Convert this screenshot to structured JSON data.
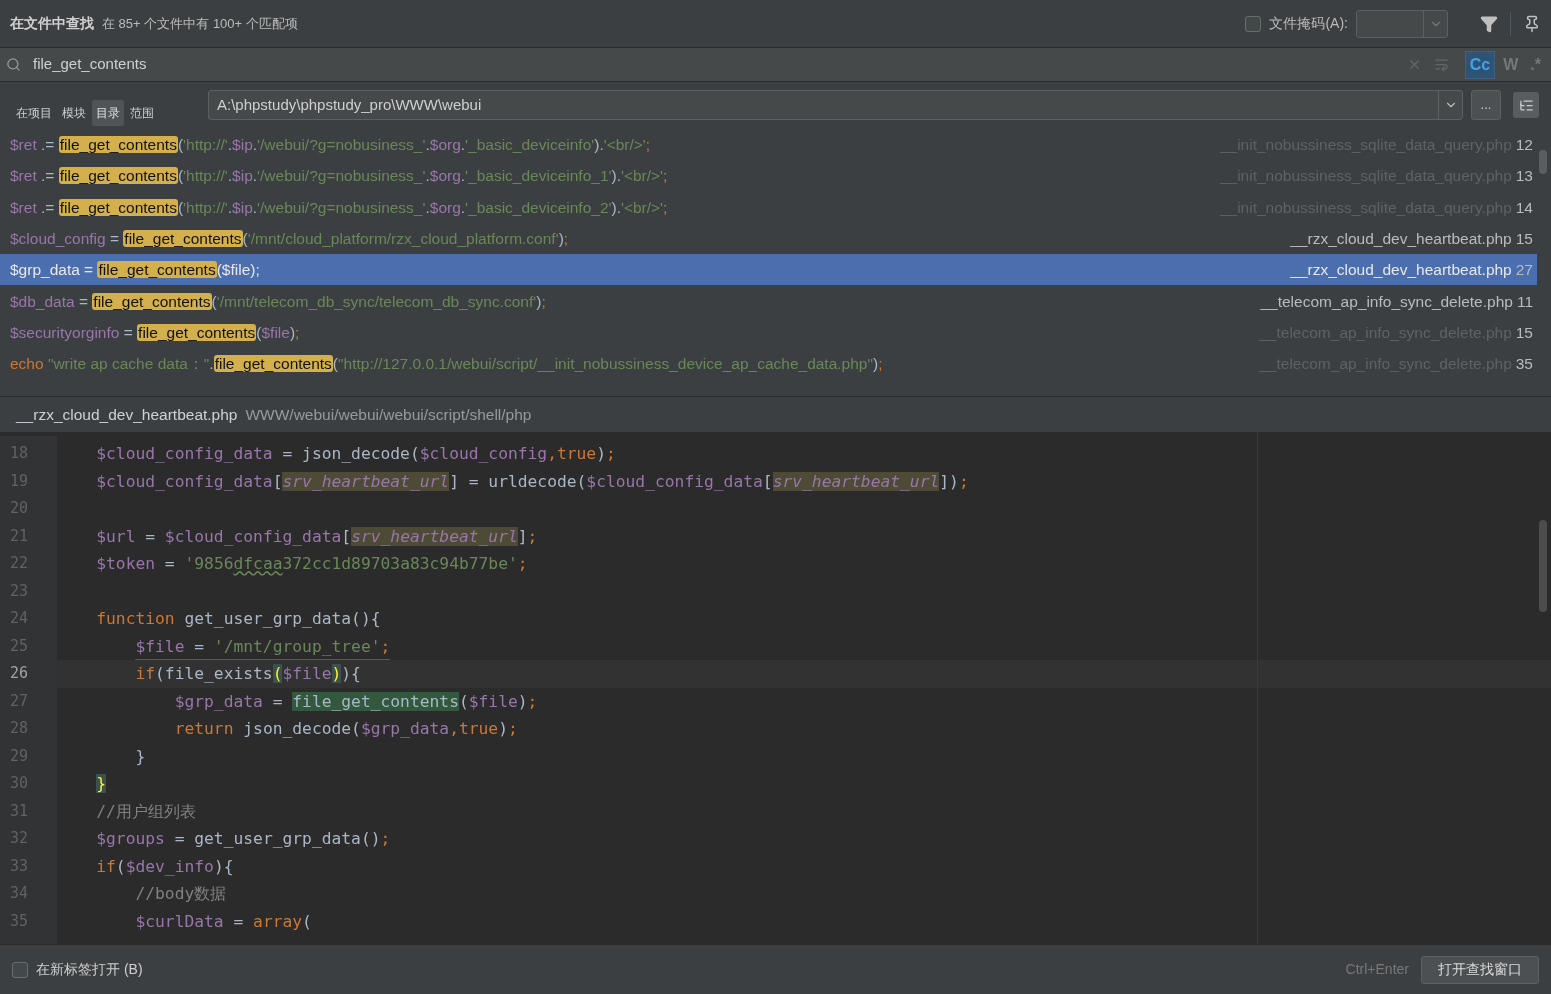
{
  "header": {
    "title": "在文件中查找",
    "summary": "在 85+ 个文件中有 100+ 个匹配项",
    "file_mask": {
      "label": "文件掩码(A):",
      "checked": false
    }
  },
  "search": {
    "value": "file_get_contents",
    "toggles": [
      {
        "label": "Cc",
        "selected": true
      },
      {
        "label": "W",
        "selected": false
      },
      {
        "label": ".*",
        "selected": false
      }
    ]
  },
  "scope": {
    "tabs": [
      {
        "label": "在项目",
        "selected": false
      },
      {
        "label": "模块",
        "selected": false
      },
      {
        "label": "目录",
        "selected": true
      },
      {
        "label": "范围",
        "selected": false
      }
    ],
    "path": "A:\\phpstudy\\phpstudy_pro\\WWW\\webui",
    "browse": "..."
  },
  "results": [
    {
      "selected": false,
      "dimmed": true,
      "file": "__init_nobussiness_sqlite_data_query.php",
      "line": "12",
      "segments": [
        {
          "kind": "var",
          "text": "$ret"
        },
        {
          "kind": "op",
          "text": " .= "
        },
        {
          "kind": "match",
          "text": "file_get_contents"
        },
        {
          "kind": "op",
          "text": "("
        },
        {
          "kind": "str",
          "text": "'http://'"
        },
        {
          "kind": "op",
          "text": "."
        },
        {
          "kind": "var",
          "text": "$ip"
        },
        {
          "kind": "op",
          "text": "."
        },
        {
          "kind": "str",
          "text": "'/webui/?g=nobusiness_'"
        },
        {
          "kind": "op",
          "text": "."
        },
        {
          "kind": "var",
          "text": "$org"
        },
        {
          "kind": "op",
          "text": "."
        },
        {
          "kind": "str",
          "text": "'_basic_deviceinfo'"
        },
        {
          "kind": "op",
          "text": ")."
        },
        {
          "kind": "str",
          "text": "'<br/>'"
        },
        {
          "kind": "kw",
          "text": ";"
        }
      ]
    },
    {
      "selected": false,
      "dimmed": true,
      "file": "__init_nobussiness_sqlite_data_query.php",
      "line": "13",
      "segments": [
        {
          "kind": "var",
          "text": "$ret"
        },
        {
          "kind": "op",
          "text": " .= "
        },
        {
          "kind": "match",
          "text": "file_get_contents"
        },
        {
          "kind": "op",
          "text": "("
        },
        {
          "kind": "str",
          "text": "'http://'"
        },
        {
          "kind": "op",
          "text": "."
        },
        {
          "kind": "var",
          "text": "$ip"
        },
        {
          "kind": "op",
          "text": "."
        },
        {
          "kind": "str",
          "text": "'/webui/?g=nobusiness_'"
        },
        {
          "kind": "op",
          "text": "."
        },
        {
          "kind": "var",
          "text": "$org"
        },
        {
          "kind": "op",
          "text": "."
        },
        {
          "kind": "str",
          "text": "'_basic_deviceinfo_1'"
        },
        {
          "kind": "op",
          "text": ")."
        },
        {
          "kind": "str",
          "text": "'<br/>'"
        },
        {
          "kind": "kw",
          "text": ";"
        }
      ]
    },
    {
      "selected": false,
      "dimmed": true,
      "file": "__init_nobussiness_sqlite_data_query.php",
      "line": "14",
      "segments": [
        {
          "kind": "var",
          "text": "$ret"
        },
        {
          "kind": "op",
          "text": " .= "
        },
        {
          "kind": "match",
          "text": "file_get_contents"
        },
        {
          "kind": "op",
          "text": "("
        },
        {
          "kind": "str",
          "text": "'http://'"
        },
        {
          "kind": "op",
          "text": "."
        },
        {
          "kind": "var",
          "text": "$ip"
        },
        {
          "kind": "op",
          "text": "."
        },
        {
          "kind": "str",
          "text": "'/webui/?g=nobusiness_'"
        },
        {
          "kind": "op",
          "text": "."
        },
        {
          "kind": "var",
          "text": "$org"
        },
        {
          "kind": "op",
          "text": "."
        },
        {
          "kind": "str",
          "text": "'_basic_deviceinfo_2'"
        },
        {
          "kind": "op",
          "text": ")."
        },
        {
          "kind": "str",
          "text": "'<br/>'"
        },
        {
          "kind": "kw",
          "text": ";"
        }
      ]
    },
    {
      "selected": false,
      "dimmed": false,
      "file": "__rzx_cloud_dev_heartbeat.php",
      "line": "15",
      "segments": [
        {
          "kind": "var",
          "text": "$cloud_config"
        },
        {
          "kind": "op",
          "text": " = "
        },
        {
          "kind": "match",
          "text": "file_get_contents"
        },
        {
          "kind": "op",
          "text": "("
        },
        {
          "kind": "str",
          "text": "'/mnt/cloud_platform/rzx_cloud_platform.conf'"
        },
        {
          "kind": "op",
          "text": ")"
        },
        {
          "kind": "kw",
          "text": ";"
        }
      ]
    },
    {
      "selected": true,
      "file": "__rzx_cloud_dev_heartbeat.php",
      "line": "27",
      "segments": [
        {
          "kind": "var",
          "text": "$grp_data"
        },
        {
          "kind": "op",
          "text": " = "
        },
        {
          "kind": "match",
          "text": "file_get_contents"
        },
        {
          "kind": "op",
          "text": "("
        },
        {
          "kind": "var",
          "text": "$file"
        },
        {
          "kind": "op",
          "text": ")"
        },
        {
          "kind": "kw",
          "text": ";"
        }
      ]
    },
    {
      "selected": false,
      "dimmed": false,
      "file": "__telecom_ap_info_sync_delete.php",
      "line": "11",
      "segments": [
        {
          "kind": "var",
          "text": "$db_data"
        },
        {
          "kind": "op",
          "text": " = "
        },
        {
          "kind": "match",
          "text": "file_get_contents"
        },
        {
          "kind": "op",
          "text": "("
        },
        {
          "kind": "str",
          "text": "'/mnt/telecom_db_sync/telecom_db_sync.conf'"
        },
        {
          "kind": "op",
          "text": ")"
        },
        {
          "kind": "kw",
          "text": ";"
        }
      ]
    },
    {
      "selected": false,
      "dimmed": true,
      "file": "__telecom_ap_info_sync_delete.php",
      "line": "15",
      "segments": [
        {
          "kind": "var",
          "text": "$securityorginfo"
        },
        {
          "kind": "op",
          "text": " = "
        },
        {
          "kind": "match",
          "text": "file_get_contents"
        },
        {
          "kind": "op",
          "text": "("
        },
        {
          "kind": "var",
          "text": "$file"
        },
        {
          "kind": "op",
          "text": ")"
        },
        {
          "kind": "kw",
          "text": ";"
        }
      ]
    },
    {
      "selected": false,
      "dimmed": true,
      "file": "__telecom_ap_info_sync_delete.php",
      "line": "35",
      "segments": [
        {
          "kind": "kw",
          "text": "echo "
        },
        {
          "kind": "str",
          "text": "\"write ap cache data：\""
        },
        {
          "kind": "op",
          "text": "."
        },
        {
          "kind": "match",
          "text": "file_get_contents"
        },
        {
          "kind": "op",
          "text": "("
        },
        {
          "kind": "str",
          "text": "\"http://127.0.0.1/webui/script/__init_nobussiness_device_ap_cache_data.php\""
        },
        {
          "kind": "op",
          "text": ")"
        },
        {
          "kind": "kw",
          "text": ";"
        }
      ]
    }
  ],
  "preview": {
    "file": "__rzx_cloud_dev_heartbeat.php",
    "path": "WWW/webui/webui/webui/script/shell/php",
    "lines": [
      {
        "number": "18",
        "current": false,
        "tokens": [
          {
            "kind": "var",
            "text": "    $cloud_config_data"
          },
          {
            "kind": "plain",
            "text": " = json_decode("
          },
          {
            "kind": "var",
            "text": "$cloud_config"
          },
          {
            "kind": "kw",
            "text": ",true"
          },
          {
            "kind": "plain",
            "text": ")"
          },
          {
            "kind": "kw",
            "text": ";"
          }
        ]
      },
      {
        "number": "19",
        "current": false,
        "tokens": [
          {
            "kind": "var",
            "text": "    $cloud_config_data"
          },
          {
            "kind": "plain",
            "text": "["
          },
          {
            "kind": "key",
            "text": "srv_heartbeat_url"
          },
          {
            "kind": "plain",
            "text": "] = urldecode("
          },
          {
            "kind": "var",
            "text": "$cloud_config_data"
          },
          {
            "kind": "plain",
            "text": "["
          },
          {
            "kind": "key",
            "text": "srv_heartbeat_url"
          },
          {
            "kind": "plain",
            "text": "])"
          },
          {
            "kind": "kw",
            "text": ";"
          }
        ]
      },
      {
        "number": "20",
        "current": false
      },
      {
        "number": "21",
        "current": false,
        "tokens": [
          {
            "kind": "var",
            "text": "    $url"
          },
          {
            "kind": "plain",
            "text": " = "
          },
          {
            "kind": "var",
            "text": "$cloud_config_data"
          },
          {
            "kind": "plain",
            "text": "["
          },
          {
            "kind": "key",
            "text": "srv_heartbeat_url"
          },
          {
            "kind": "plain",
            "text": "]"
          },
          {
            "kind": "kw",
            "text": ";"
          }
        ]
      },
      {
        "number": "22",
        "current": false,
        "tokens": [
          {
            "kind": "var",
            "text": "    $token"
          },
          {
            "kind": "plain",
            "text": " = "
          },
          {
            "kind": "str",
            "text": "'9856"
          },
          {
            "kind": "typo",
            "text": "dfcaa"
          },
          {
            "kind": "str",
            "text": "372cc1d89703a83c94b77be'"
          },
          {
            "kind": "kw",
            "text": ";"
          }
        ]
      },
      {
        "number": "23",
        "current": false
      },
      {
        "number": "24",
        "current": false,
        "tokens": [
          {
            "kind": "kw",
            "text": "    function"
          },
          {
            "kind": "plain",
            "text": " get_user_grp_data(){"
          }
        ]
      },
      {
        "number": "25",
        "current": false,
        "underlined": true,
        "tokens": [
          {
            "kind": "var",
            "text": "        $file"
          },
          {
            "kind": "plain",
            "text": " = "
          },
          {
            "kind": "str",
            "text": "'/mnt/group_tree'"
          },
          {
            "kind": "kw",
            "text": ";"
          }
        ]
      },
      {
        "number": "26",
        "current": true,
        "tokens": [
          {
            "kind": "kw",
            "text": "        if"
          },
          {
            "kind": "plain",
            "text": "(file_exists"
          },
          {
            "kind": "paren",
            "text": "("
          },
          {
            "kind": "var",
            "text": "$file"
          },
          {
            "kind": "paren",
            "text": ")"
          },
          {
            "kind": "plain",
            "text": "){"
          }
        ]
      },
      {
        "number": "27",
        "current": false,
        "tokens": [
          {
            "kind": "var",
            "text": "            $grp_data"
          },
          {
            "kind": "plain",
            "text": " = "
          },
          {
            "kind": "match",
            "text": "file_get_contents"
          },
          {
            "kind": "plain",
            "text": "("
          },
          {
            "kind": "var",
            "text": "$file"
          },
          {
            "kind": "plain",
            "text": ")"
          },
          {
            "kind": "kw",
            "text": ";"
          }
        ]
      },
      {
        "number": "28",
        "current": false,
        "tokens": [
          {
            "kind": "kw",
            "text": "            return"
          },
          {
            "kind": "plain",
            "text": " json_decode("
          },
          {
            "kind": "var",
            "text": "$grp_data"
          },
          {
            "kind": "kw",
            "text": ",true"
          },
          {
            "kind": "plain",
            "text": ")"
          },
          {
            "kind": "kw",
            "text": ";"
          }
        ]
      },
      {
        "number": "29",
        "current": false,
        "tokens": [
          {
            "kind": "plain",
            "text": "        }"
          }
        ]
      },
      {
        "number": "30",
        "current": false,
        "tokens": [
          {
            "kind": "paren",
            "text": "    }"
          }
        ]
      },
      {
        "number": "31",
        "current": false,
        "tokens": [
          {
            "kind": "comment",
            "text": "    //用户组列表"
          }
        ]
      },
      {
        "number": "32",
        "current": false,
        "tokens": [
          {
            "kind": "var",
            "text": "    $groups"
          },
          {
            "kind": "plain",
            "text": " = get_user_grp_data()"
          },
          {
            "kind": "kw",
            "text": ";"
          }
        ]
      },
      {
        "number": "33",
        "current": false,
        "tokens": [
          {
            "kind": "kw",
            "text": "    if"
          },
          {
            "kind": "plain",
            "text": "("
          },
          {
            "kind": "var",
            "text": "$dev_info"
          },
          {
            "kind": "plain",
            "text": "){"
          }
        ]
      },
      {
        "number": "34",
        "current": false,
        "tokens": [
          {
            "kind": "comment",
            "text": "        //body数据"
          }
        ]
      },
      {
        "number": "35",
        "current": false,
        "tokens": [
          {
            "kind": "var",
            "text": "        $curlData"
          },
          {
            "kind": "plain",
            "text": " = "
          },
          {
            "kind": "kw",
            "text": "array"
          },
          {
            "kind": "plain",
            "text": "("
          }
        ]
      }
    ]
  },
  "footer": {
    "new_tab": {
      "label": "在新标签打开 (B)",
      "checked": false
    },
    "shortcut": "Ctrl+Enter",
    "open_button": "打开查找窗口"
  }
}
